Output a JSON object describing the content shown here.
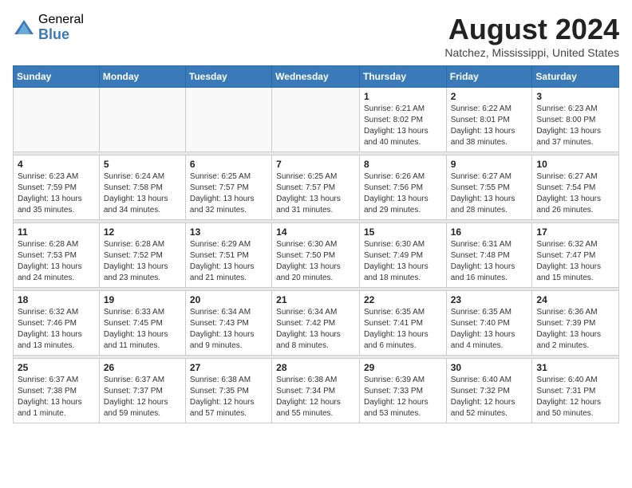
{
  "logo": {
    "general": "General",
    "blue": "Blue"
  },
  "title": "August 2024",
  "location": "Natchez, Mississippi, United States",
  "weekdays": [
    "Sunday",
    "Monday",
    "Tuesday",
    "Wednesday",
    "Thursday",
    "Friday",
    "Saturday"
  ],
  "weeks": [
    [
      {
        "day": "",
        "info": ""
      },
      {
        "day": "",
        "info": ""
      },
      {
        "day": "",
        "info": ""
      },
      {
        "day": "",
        "info": ""
      },
      {
        "day": "1",
        "info": "Sunrise: 6:21 AM\nSunset: 8:02 PM\nDaylight: 13 hours\nand 40 minutes."
      },
      {
        "day": "2",
        "info": "Sunrise: 6:22 AM\nSunset: 8:01 PM\nDaylight: 13 hours\nand 38 minutes."
      },
      {
        "day": "3",
        "info": "Sunrise: 6:23 AM\nSunset: 8:00 PM\nDaylight: 13 hours\nand 37 minutes."
      }
    ],
    [
      {
        "day": "4",
        "info": "Sunrise: 6:23 AM\nSunset: 7:59 PM\nDaylight: 13 hours\nand 35 minutes."
      },
      {
        "day": "5",
        "info": "Sunrise: 6:24 AM\nSunset: 7:58 PM\nDaylight: 13 hours\nand 34 minutes."
      },
      {
        "day": "6",
        "info": "Sunrise: 6:25 AM\nSunset: 7:57 PM\nDaylight: 13 hours\nand 32 minutes."
      },
      {
        "day": "7",
        "info": "Sunrise: 6:25 AM\nSunset: 7:57 PM\nDaylight: 13 hours\nand 31 minutes."
      },
      {
        "day": "8",
        "info": "Sunrise: 6:26 AM\nSunset: 7:56 PM\nDaylight: 13 hours\nand 29 minutes."
      },
      {
        "day": "9",
        "info": "Sunrise: 6:27 AM\nSunset: 7:55 PM\nDaylight: 13 hours\nand 28 minutes."
      },
      {
        "day": "10",
        "info": "Sunrise: 6:27 AM\nSunset: 7:54 PM\nDaylight: 13 hours\nand 26 minutes."
      }
    ],
    [
      {
        "day": "11",
        "info": "Sunrise: 6:28 AM\nSunset: 7:53 PM\nDaylight: 13 hours\nand 24 minutes."
      },
      {
        "day": "12",
        "info": "Sunrise: 6:28 AM\nSunset: 7:52 PM\nDaylight: 13 hours\nand 23 minutes."
      },
      {
        "day": "13",
        "info": "Sunrise: 6:29 AM\nSunset: 7:51 PM\nDaylight: 13 hours\nand 21 minutes."
      },
      {
        "day": "14",
        "info": "Sunrise: 6:30 AM\nSunset: 7:50 PM\nDaylight: 13 hours\nand 20 minutes."
      },
      {
        "day": "15",
        "info": "Sunrise: 6:30 AM\nSunset: 7:49 PM\nDaylight: 13 hours\nand 18 minutes."
      },
      {
        "day": "16",
        "info": "Sunrise: 6:31 AM\nSunset: 7:48 PM\nDaylight: 13 hours\nand 16 minutes."
      },
      {
        "day": "17",
        "info": "Sunrise: 6:32 AM\nSunset: 7:47 PM\nDaylight: 13 hours\nand 15 minutes."
      }
    ],
    [
      {
        "day": "18",
        "info": "Sunrise: 6:32 AM\nSunset: 7:46 PM\nDaylight: 13 hours\nand 13 minutes."
      },
      {
        "day": "19",
        "info": "Sunrise: 6:33 AM\nSunset: 7:45 PM\nDaylight: 13 hours\nand 11 minutes."
      },
      {
        "day": "20",
        "info": "Sunrise: 6:34 AM\nSunset: 7:43 PM\nDaylight: 13 hours\nand 9 minutes."
      },
      {
        "day": "21",
        "info": "Sunrise: 6:34 AM\nSunset: 7:42 PM\nDaylight: 13 hours\nand 8 minutes."
      },
      {
        "day": "22",
        "info": "Sunrise: 6:35 AM\nSunset: 7:41 PM\nDaylight: 13 hours\nand 6 minutes."
      },
      {
        "day": "23",
        "info": "Sunrise: 6:35 AM\nSunset: 7:40 PM\nDaylight: 13 hours\nand 4 minutes."
      },
      {
        "day": "24",
        "info": "Sunrise: 6:36 AM\nSunset: 7:39 PM\nDaylight: 13 hours\nand 2 minutes."
      }
    ],
    [
      {
        "day": "25",
        "info": "Sunrise: 6:37 AM\nSunset: 7:38 PM\nDaylight: 13 hours\nand 1 minute."
      },
      {
        "day": "26",
        "info": "Sunrise: 6:37 AM\nSunset: 7:37 PM\nDaylight: 12 hours\nand 59 minutes."
      },
      {
        "day": "27",
        "info": "Sunrise: 6:38 AM\nSunset: 7:35 PM\nDaylight: 12 hours\nand 57 minutes."
      },
      {
        "day": "28",
        "info": "Sunrise: 6:38 AM\nSunset: 7:34 PM\nDaylight: 12 hours\nand 55 minutes."
      },
      {
        "day": "29",
        "info": "Sunrise: 6:39 AM\nSunset: 7:33 PM\nDaylight: 12 hours\nand 53 minutes."
      },
      {
        "day": "30",
        "info": "Sunrise: 6:40 AM\nSunset: 7:32 PM\nDaylight: 12 hours\nand 52 minutes."
      },
      {
        "day": "31",
        "info": "Sunrise: 6:40 AM\nSunset: 7:31 PM\nDaylight: 12 hours\nand 50 minutes."
      }
    ]
  ]
}
